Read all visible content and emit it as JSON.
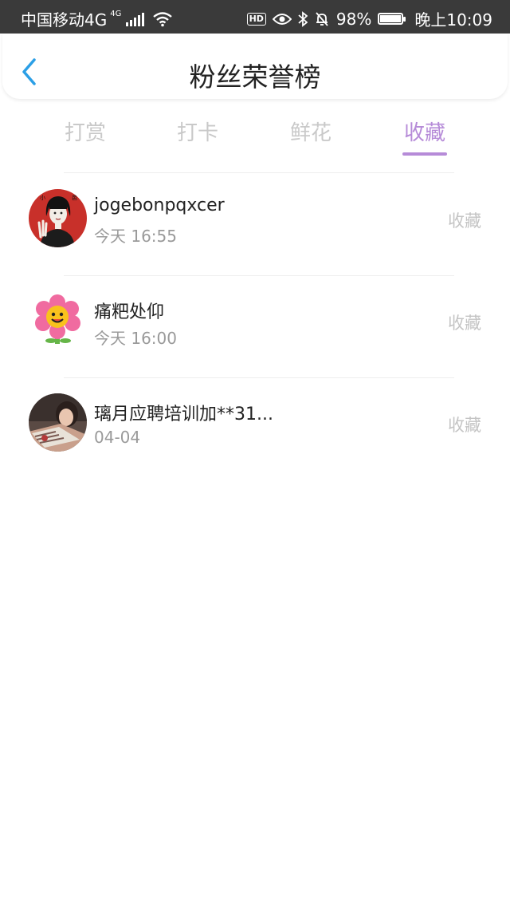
{
  "status_bar": {
    "carrier": "中国移动4G",
    "network_badge": "4G",
    "hd_label": "HD",
    "battery_percent": "98%",
    "battery_level": 0.98,
    "clock": "晚上10:09",
    "icons": [
      "signal-icon",
      "wifi-icon",
      "eye-icon",
      "bluetooth-icon",
      "mute-bell-icon",
      "battery-icon"
    ]
  },
  "header": {
    "title": "粉丝荣誉榜",
    "back_icon": "chevron-left-icon",
    "accent_color": "#2b9fe6"
  },
  "tabs": [
    {
      "label": "打赏",
      "active": false
    },
    {
      "label": "打卡",
      "active": false
    },
    {
      "label": "鲜花",
      "active": false
    },
    {
      "label": "收藏",
      "active": true
    }
  ],
  "active_tab_color": "#b68bd8",
  "list": [
    {
      "name": "jogebonpqxcer",
      "time": "今天 16:55",
      "action": "收藏",
      "avatar": "portrait-avatar"
    },
    {
      "name": "痛粑处仰",
      "time": "今天 16:00",
      "action": "收藏",
      "avatar": "flower-avatar"
    },
    {
      "name": "璃月应聘培训加**31...",
      "time": "04-04",
      "action": "收藏",
      "avatar": "photo-avatar"
    }
  ]
}
